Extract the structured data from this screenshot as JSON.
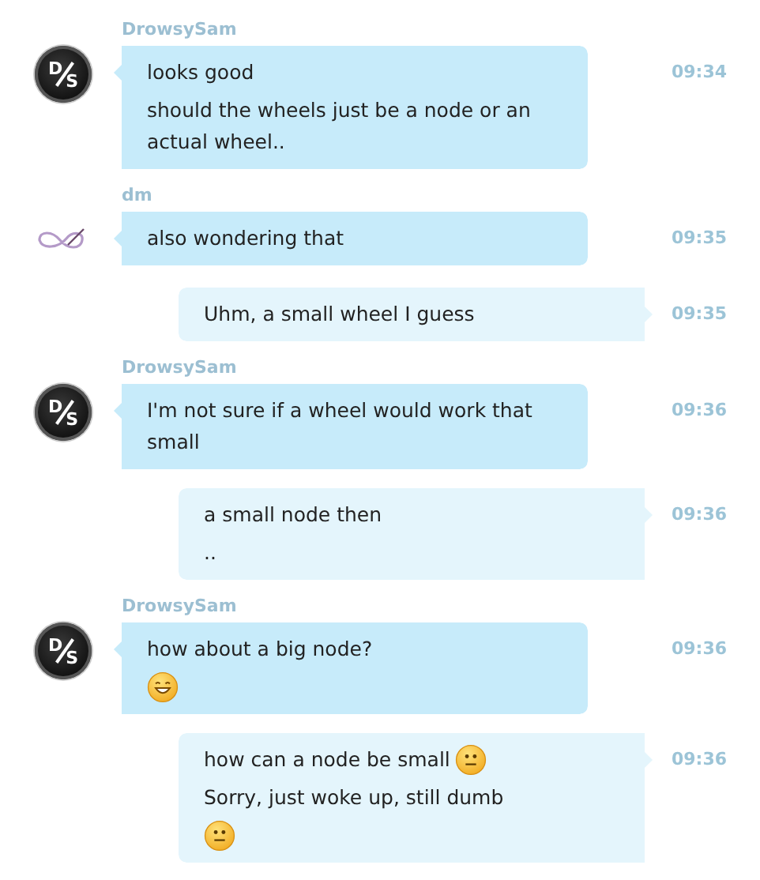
{
  "messages": [
    {
      "kind": "incoming",
      "sender": "DrowsySam",
      "avatar": {
        "kind": "monogram",
        "letters": [
          "D",
          "S"
        ]
      },
      "lines": [
        {
          "text": "looks good"
        },
        {
          "text": "should the wheels just be a node or an actual wheel.."
        }
      ],
      "time": "09:34"
    },
    {
      "kind": "incoming",
      "sender": "dm",
      "avatar": {
        "kind": "loops"
      },
      "lines": [
        {
          "text": "also wondering that"
        }
      ],
      "time": "09:35"
    },
    {
      "kind": "outgoing",
      "lines": [
        {
          "text": "Uhm, a small wheel I guess"
        }
      ],
      "time": "09:35"
    },
    {
      "kind": "incoming",
      "sender": "DrowsySam",
      "avatar": {
        "kind": "monogram",
        "letters": [
          "D",
          "S"
        ]
      },
      "lines": [
        {
          "text": "I'm not sure if a wheel would work that small"
        }
      ],
      "time": "09:36"
    },
    {
      "kind": "outgoing",
      "lines": [
        {
          "text": "a small node then"
        },
        {
          "text": ".."
        }
      ],
      "time": "09:36"
    },
    {
      "kind": "incoming",
      "sender": "DrowsySam",
      "avatar": {
        "kind": "monogram",
        "letters": [
          "D",
          "S"
        ]
      },
      "lines": [
        {
          "kind": "text",
          "text": "how about a big node?"
        },
        {
          "kind": "grin"
        }
      ],
      "time": "09:36"
    },
    {
      "kind": "outgoing",
      "lines": [
        {
          "kind": "text_neutral",
          "text": "how can a node be small"
        },
        {
          "kind": "text",
          "text": "Sorry, just woke up, still dumb"
        },
        {
          "kind": "neutral"
        }
      ],
      "time": "09:36"
    }
  ]
}
